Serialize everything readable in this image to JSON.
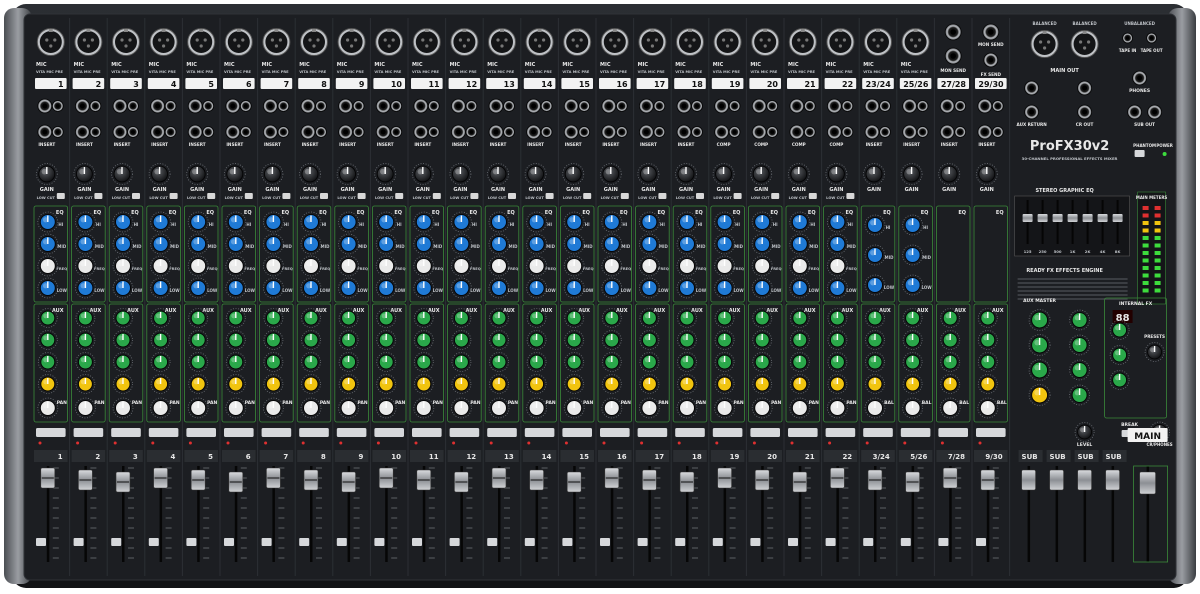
{
  "brand": {
    "name": "ProFX30v2",
    "subtitle": "30-CHANNEL PROFESSIONAL EFFECTS MIXER"
  },
  "mono_channels": [
    "1",
    "2",
    "3",
    "4",
    "5",
    "6",
    "7",
    "8",
    "9",
    "10",
    "11",
    "12",
    "13",
    "14",
    "15",
    "16",
    "17",
    "18",
    "19",
    "20",
    "21",
    "22"
  ],
  "stereo_channels": [
    "23/24",
    "25/26",
    "27/28",
    "29/30"
  ],
  "fader_strip_labels": [
    "1",
    "2",
    "3",
    "4",
    "5",
    "6",
    "7",
    "8",
    "9",
    "10",
    "11",
    "12",
    "13",
    "14",
    "15",
    "16",
    "17",
    "18",
    "19",
    "20",
    "21",
    "22",
    "3/24",
    "5/26",
    "7/28",
    "9/30"
  ],
  "labels": {
    "mic": "MIC",
    "vita": "VITA MIC PRE",
    "insert": "INSERT",
    "gain": "GAIN",
    "low_cut": "LOW CUT",
    "comp": "COMP",
    "eq": "EQ",
    "hi": "HI",
    "mid": "MID",
    "freq": "FREQ",
    "low": "LOW",
    "aux": "AUX",
    "pan": "PAN",
    "bal": "BAL",
    "main": "MAIN",
    "mon_send": "MON SEND",
    "fx_send": "FX SEND",
    "main_out": "MAIN OUT",
    "aux_return": "AUX RETURN",
    "cr_out": "CR OUT",
    "sub_out": "SUB OUT",
    "phones": "PHONES",
    "tape_in": "TAPE IN",
    "tape_out": "TAPE OUT",
    "balanced": "BALANCED",
    "unbalanced": "UNBALANCED",
    "phantom": "PHANTOM",
    "power": "POWER",
    "stereo_geq": "STEREO GRAPHIC EQ",
    "main_meters": "MAIN METERS",
    "ready_fx": "READY FX EFFECTS ENGINE",
    "internal_fx": "INTERNAL FX",
    "presets": "PRESETS",
    "break": "BREAK",
    "aux_master": "AUX MASTER",
    "level": "LEVEL",
    "cr_phones": "CR/PHONES",
    "sub": "SUB",
    "fx_display": "88"
  },
  "geq_bands": [
    "125",
    "250",
    "500",
    "1K",
    "2K",
    "4K",
    "8K"
  ],
  "colors": {
    "panel": "#1b1d20",
    "eq_knob": "#1f7ad6",
    "aux_knob": "#2aa84a",
    "fx_knob": "#f1c40f",
    "led_green": "#3ddc3d",
    "led_red": "#e03030",
    "strip_line": "#3a8a3a",
    "label_box": "#f2f2f2"
  }
}
